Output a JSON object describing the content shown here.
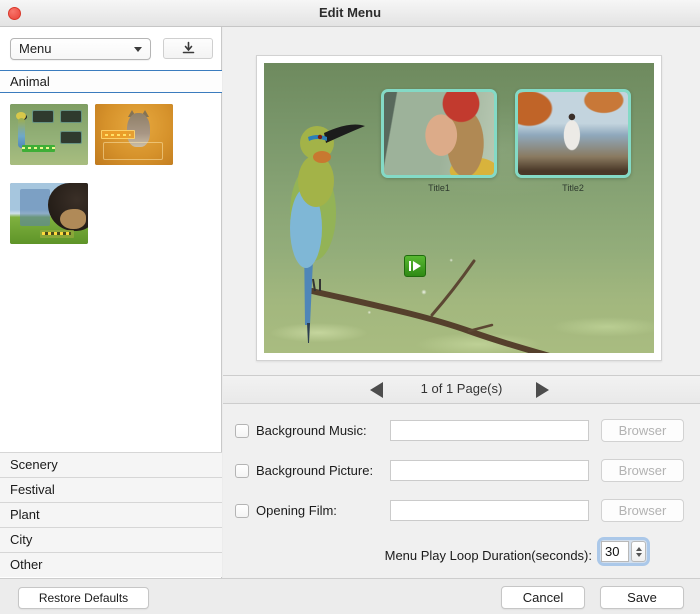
{
  "window": {
    "title": "Edit Menu"
  },
  "sidebar": {
    "menu_dropdown_value": "Menu",
    "category_header": "Animal",
    "thumbnails": [
      {
        "name": "bird-grass-menu-template"
      },
      {
        "name": "kitten-autumn-menu-template"
      },
      {
        "name": "dog-grass-menu-template"
      }
    ],
    "categories": [
      {
        "label": "Scenery"
      },
      {
        "label": "Festival"
      },
      {
        "label": "Plant"
      },
      {
        "label": "City"
      },
      {
        "label": "Other"
      }
    ],
    "restore_defaults_label": "Restore Defaults"
  },
  "preview": {
    "title_labels": [
      {
        "label": "Title1"
      },
      {
        "label": "Title2"
      }
    ],
    "pager_text": "1 of 1 Page(s)"
  },
  "form": {
    "rows": [
      {
        "label": "Background Music:",
        "value": "",
        "button_label": "Browser",
        "checked": false
      },
      {
        "label": "Background Picture:",
        "value": "",
        "button_label": "Browser",
        "checked": false
      },
      {
        "label": "Opening Film:",
        "value": "",
        "button_label": "Browser",
        "checked": false
      }
    ],
    "duration_label": "Menu Play Loop Duration(seconds):",
    "duration_value": "30"
  },
  "footer": {
    "cancel_label": "Cancel",
    "save_label": "Save"
  },
  "colors": {
    "accent_blue": "#3b7cbe",
    "focus_ring": "#7dade4",
    "frame_teal": "#84dac6",
    "play_green": "#3f9e1e"
  }
}
